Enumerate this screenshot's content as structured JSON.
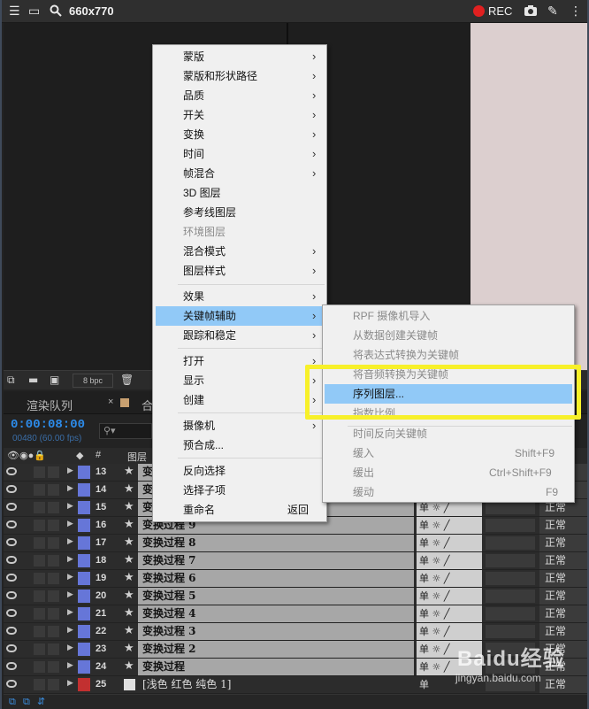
{
  "recorder": {
    "size_label": "660x770",
    "rec_label": "REC"
  },
  "viewer_toolbar": {
    "bpc_label": "8 bpc"
  },
  "timeline": {
    "tab_render": "渲染队列",
    "tab_comp": "合",
    "timecode": "0:00:08:00",
    "fps_text": "00480 (60.00 fps)",
    "col_num": "#",
    "col_layer": "图层"
  },
  "layers": [
    {
      "num": "13",
      "name": "变",
      "mode": "正常"
    },
    {
      "num": "14",
      "name": "变",
      "mode": "正常"
    },
    {
      "num": "15",
      "name": "变",
      "mode": "正常"
    },
    {
      "num": "16",
      "name": "变换过程 9",
      "mode": "正常"
    },
    {
      "num": "17",
      "name": "变换过程 8",
      "mode": "正常"
    },
    {
      "num": "18",
      "name": "变换过程 7",
      "mode": "正常"
    },
    {
      "num": "19",
      "name": "变换过程 6",
      "mode": "正常"
    },
    {
      "num": "20",
      "name": "变换过程 5",
      "mode": "正常"
    },
    {
      "num": "21",
      "name": "变换过程 4",
      "mode": "正常"
    },
    {
      "num": "22",
      "name": "变换过程 3",
      "mode": "正常"
    },
    {
      "num": "23",
      "name": "变换过程 2",
      "mode": "正常"
    },
    {
      "num": "24",
      "name": "变换过程",
      "mode": "正常"
    },
    {
      "num": "25",
      "name": "[浅色 红色 纯色 1]",
      "mode": "正常"
    }
  ],
  "layer_switch_glyph": "单",
  "context_menu": {
    "items": [
      {
        "label": "蒙版",
        "submenu": true
      },
      {
        "label": "蒙版和形状路径",
        "submenu": true
      },
      {
        "label": "品质",
        "submenu": true
      },
      {
        "label": "开关",
        "submenu": true
      },
      {
        "label": "变换",
        "submenu": true
      },
      {
        "label": "时间",
        "submenu": true
      },
      {
        "label": "帧混合",
        "submenu": true
      },
      {
        "label": "3D 图层",
        "submenu": false
      },
      {
        "label": "参考线图层",
        "submenu": false
      },
      {
        "label": "环境图层",
        "submenu": false,
        "disabled": true
      },
      {
        "label": "混合模式",
        "submenu": true
      },
      {
        "label": "图层样式",
        "submenu": true
      },
      {
        "label": "效果",
        "submenu": true
      },
      {
        "label": "关键帧辅助",
        "submenu": true,
        "highlighted": true
      },
      {
        "label": "跟踪和稳定",
        "submenu": true
      },
      {
        "label": "打开",
        "submenu": true
      },
      {
        "label": "显示",
        "submenu": true
      },
      {
        "label": "创建",
        "submenu": true
      },
      {
        "label": "摄像机",
        "submenu": true
      },
      {
        "label": "预合成...",
        "submenu": false
      },
      {
        "label": "反向选择",
        "submenu": false
      },
      {
        "label": "选择子项",
        "submenu": false
      },
      {
        "label": "重命名",
        "submenu": false,
        "shortcut": "返回"
      }
    ]
  },
  "keyframe_submenu": {
    "items": [
      {
        "label": "RPF 摄像机导入",
        "disabled": true
      },
      {
        "label": "从数据创建关键帧",
        "disabled": true
      },
      {
        "label": "将表达式转换为关键帧",
        "disabled": true
      },
      {
        "label": "将音频转换为关键帧",
        "disabled": true
      },
      {
        "label": "序列图层...",
        "highlighted": true
      },
      {
        "label": "指数比例",
        "disabled": true
      },
      {
        "label": "时间反向关键帧",
        "disabled": true
      },
      {
        "label": "缓入",
        "shortcut": "Shift+F9",
        "disabled": true
      },
      {
        "label": "缓出",
        "shortcut": "Ctrl+Shift+F9",
        "disabled": true
      },
      {
        "label": "缓动",
        "shortcut": "F9",
        "disabled": true
      }
    ]
  },
  "watermark": {
    "brand": "Baidu经验",
    "url": "jingyan.baidu.com"
  },
  "colors": {
    "accent_blue": "#2d8ceb",
    "menu_highlight": "#91c9f7",
    "callout_yellow": "#f7f02a",
    "rec_red": "#e02020",
    "layer_label_purple": "#6676d8",
    "layer_label_red": "#c23030"
  },
  "icons": [
    "menu-icon",
    "window-icon",
    "search-icon",
    "rec-dot-icon",
    "camera-icon",
    "pen-icon",
    "more-icon",
    "eye-icon",
    "star-icon",
    "twirl-triangle-icon",
    "chevron-right-icon"
  ]
}
